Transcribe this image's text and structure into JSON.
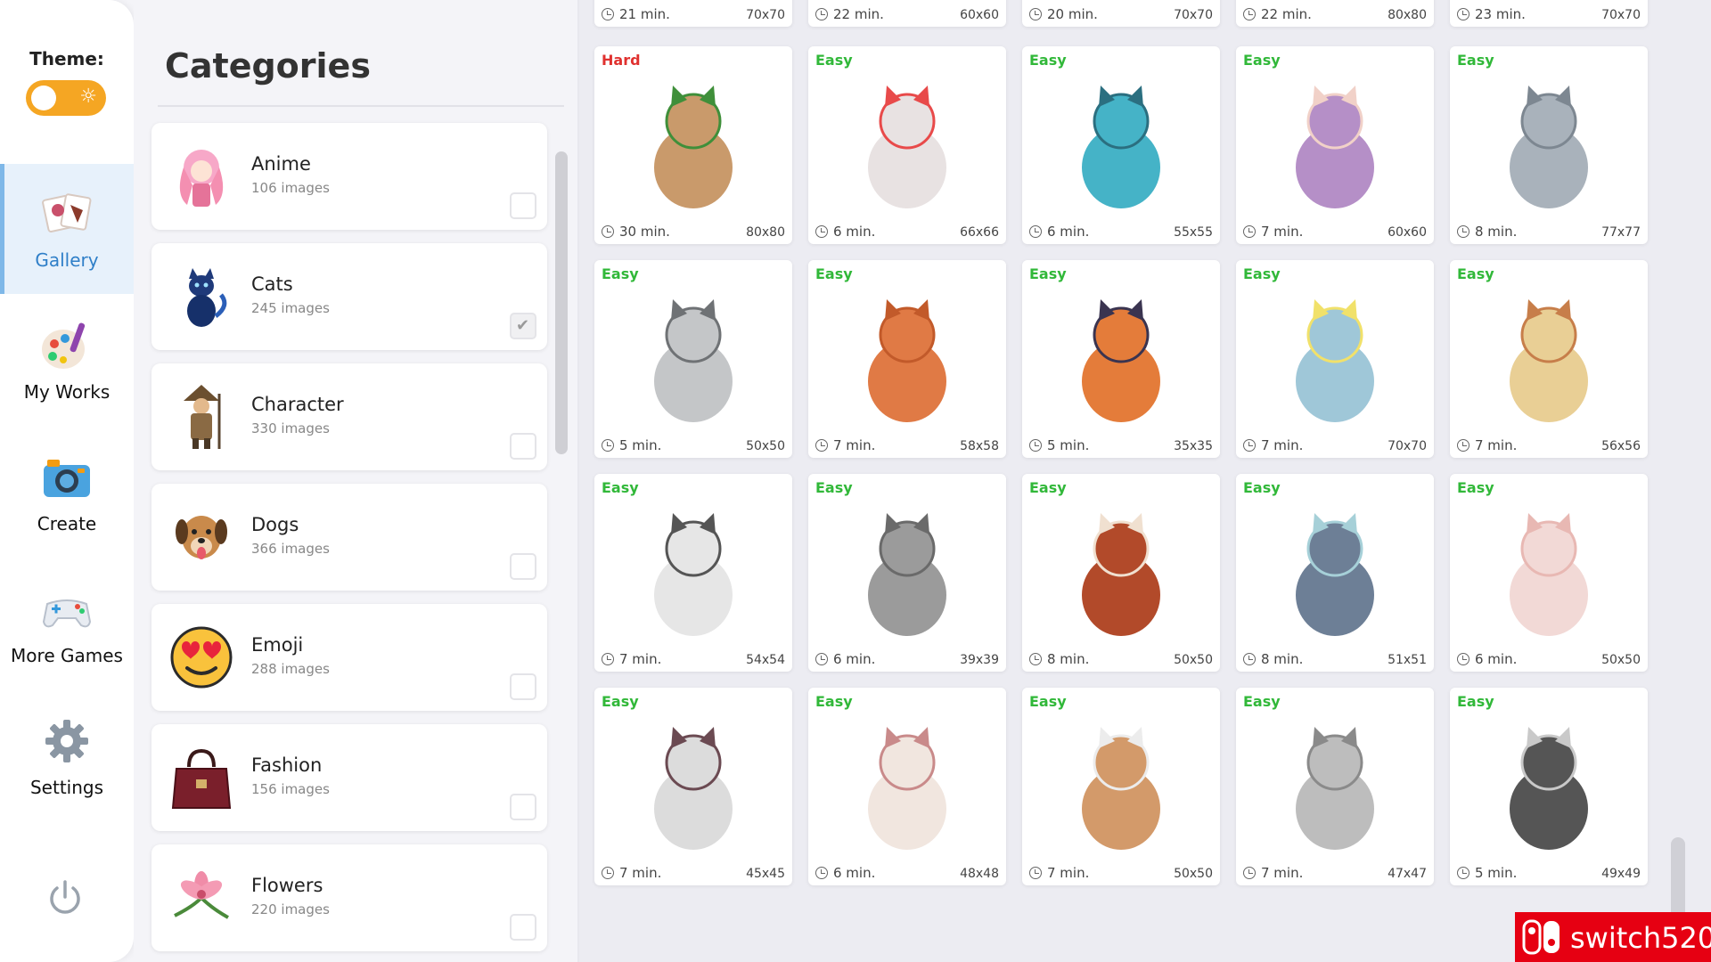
{
  "sidebar": {
    "theme_label": "Theme:",
    "theme_toggle_icon": "sun-icon",
    "nav": [
      {
        "label": "Gallery",
        "icon": "gallery-icon",
        "active": true
      },
      {
        "label": "My Works",
        "icon": "palette-icon",
        "active": false
      },
      {
        "label": "Create",
        "icon": "camera-icon",
        "active": false
      },
      {
        "label": "More Games",
        "icon": "gamepad-icon",
        "active": false
      },
      {
        "label": "Settings",
        "icon": "gear-icon",
        "active": false
      }
    ],
    "power_icon": "power-icon"
  },
  "categories": {
    "title": "Categories",
    "items": [
      {
        "name": "Anime",
        "count": "106 images",
        "checked": false,
        "icon": "anime-thumb"
      },
      {
        "name": "Cats",
        "count": "245 images",
        "checked": true,
        "icon": "cat-thumb"
      },
      {
        "name": "Character",
        "count": "330 images",
        "checked": false,
        "icon": "character-thumb"
      },
      {
        "name": "Dogs",
        "count": "366 images",
        "checked": false,
        "icon": "dog-thumb"
      },
      {
        "name": "Emoji",
        "count": "288 images",
        "checked": false,
        "icon": "emoji-thumb"
      },
      {
        "name": "Fashion",
        "count": "156 images",
        "checked": false,
        "icon": "handbag-thumb"
      },
      {
        "name": "Flowers",
        "count": "220 images",
        "checked": false,
        "icon": "flower-thumb"
      }
    ]
  },
  "gallery": {
    "top_row": [
      {
        "time": "21 min.",
        "size": "70x70"
      },
      {
        "time": "22 min.",
        "size": "60x60"
      },
      {
        "time": "20 min.",
        "size": "70x70"
      },
      {
        "time": "22 min.",
        "size": "80x80"
      },
      {
        "time": "23 min.",
        "size": "70x70"
      }
    ],
    "tiles": [
      {
        "difficulty": "Hard",
        "time": "30 min.",
        "size": "80x80",
        "art": "cat-tree-art"
      },
      {
        "difficulty": "Easy",
        "time": "6 min.",
        "size": "66x66",
        "art": "balloon-cat-art"
      },
      {
        "difficulty": "Easy",
        "time": "6 min.",
        "size": "55x55",
        "art": "leaping-cat-art"
      },
      {
        "difficulty": "Easy",
        "time": "7 min.",
        "size": "60x60",
        "art": "blanket-cat-art"
      },
      {
        "difficulty": "Easy",
        "time": "8 min.",
        "size": "77x77",
        "art": "grey-cat-art"
      },
      {
        "difficulty": "Easy",
        "time": "5 min.",
        "size": "50x50",
        "art": "sitting-cat-art"
      },
      {
        "difficulty": "Easy",
        "time": "7 min.",
        "size": "58x58",
        "art": "pot-cat-art"
      },
      {
        "difficulty": "Easy",
        "time": "5 min.",
        "size": "35x35",
        "art": "two-cats-art"
      },
      {
        "difficulty": "Easy",
        "time": "7 min.",
        "size": "70x70",
        "art": "rain-cat-art"
      },
      {
        "difficulty": "Easy",
        "time": "7 min.",
        "size": "56x56",
        "art": "moon-cat-art"
      },
      {
        "difficulty": "Easy",
        "time": "7 min.",
        "size": "54x54",
        "art": "butterfly-cat-art"
      },
      {
        "difficulty": "Easy",
        "time": "6 min.",
        "size": "39x39",
        "art": "sunglasses-cat-art"
      },
      {
        "difficulty": "Easy",
        "time": "8 min.",
        "size": "50x50",
        "art": "owl-cat-art"
      },
      {
        "difficulty": "Easy",
        "time": "8 min.",
        "size": "51x51",
        "art": "chubby-cat-art"
      },
      {
        "difficulty": "Easy",
        "time": "6 min.",
        "size": "50x50",
        "art": "sleeping-cat-art"
      },
      {
        "difficulty": "Easy",
        "time": "7 min.",
        "size": "45x45",
        "art": "ball-cat-art"
      },
      {
        "difficulty": "Easy",
        "time": "6 min.",
        "size": "48x48",
        "art": "waving-cat-art"
      },
      {
        "difficulty": "Easy",
        "time": "7 min.",
        "size": "50x50",
        "art": "box-cat-art"
      },
      {
        "difficulty": "Easy",
        "time": "7 min.",
        "size": "47x47",
        "art": "crown-cat-art"
      },
      {
        "difficulty": "Easy",
        "time": "5 min.",
        "size": "49x49",
        "art": "balloon-kitten-art"
      }
    ]
  },
  "watermark": {
    "text": "switch520"
  },
  "colors": {
    "easy": "#31b839",
    "hard": "#e0312f",
    "toggle": "#f5a623",
    "active_nav": "#2f7fc8",
    "watermark": "#e60012"
  }
}
